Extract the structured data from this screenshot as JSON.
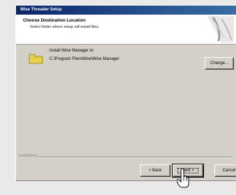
{
  "window": {
    "title": "Wise Threader Setup"
  },
  "header": {
    "title": "Choose Destination Location",
    "subtitle": "Select folder where setup will install files."
  },
  "install": {
    "label": "Install Wise Manager to:",
    "path": "C:\\Program Files\\Wise\\Wise Manager"
  },
  "buttons": {
    "change": "Change...",
    "back": "< Back",
    "next": "Next >",
    "cancel": "Cancel"
  },
  "footer": {
    "brand": "InstallShield"
  },
  "icons": {
    "folder": "folder-icon",
    "cursor": "hand-pointer-icon",
    "logo": "setup-logo-icon"
  }
}
